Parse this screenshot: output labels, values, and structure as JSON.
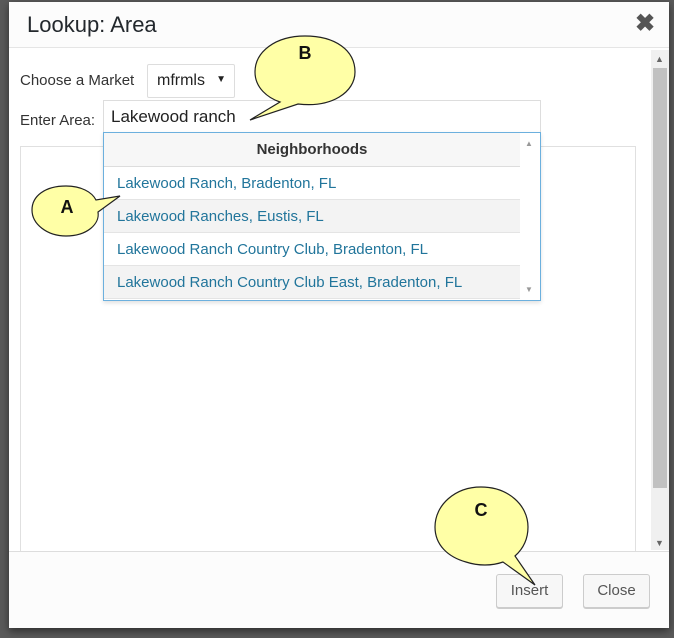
{
  "dialog": {
    "title": "Lookup: Area",
    "close_symbol": "✖"
  },
  "form": {
    "market_label": "Choose a Market",
    "market_value": "mfrmls",
    "area_label": "Enter Area:",
    "area_value": "Lakewood ranch"
  },
  "dropdown": {
    "header": "Neighborhoods",
    "items": [
      "Lakewood Ranch, Bradenton, FL",
      "Lakewood Ranches, Eustis, FL",
      "Lakewood Ranch Country Club, Bradenton, FL",
      "Lakewood Ranch Country Club East, Bradenton, FL"
    ]
  },
  "footer": {
    "insert_label": "Insert",
    "close_label": "Close"
  },
  "callouts": {
    "a": "A",
    "b": "B",
    "c": "C"
  },
  "colors": {
    "callout_fill": "#ffffa6",
    "link": "#21759b",
    "dropdown_border": "#6cb0de"
  },
  "icons": {
    "close": "close-icon",
    "select_arrow": "triangle-down-icon",
    "scroll_up": "triangle-up-icon",
    "scroll_down": "triangle-down-icon"
  }
}
